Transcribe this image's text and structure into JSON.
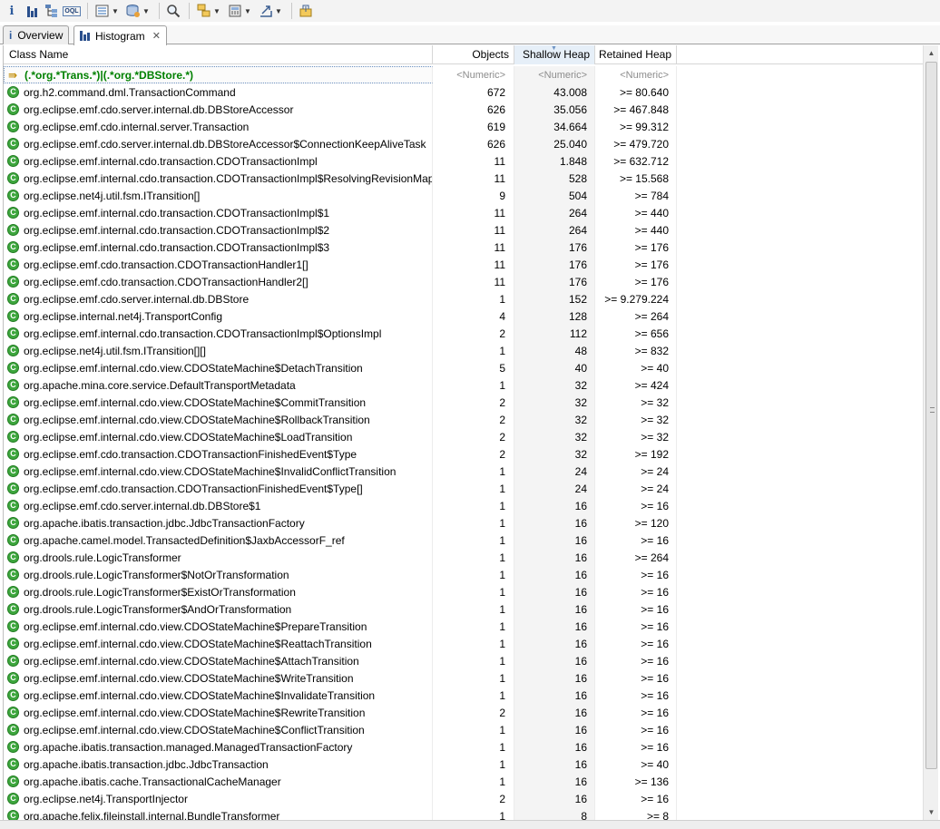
{
  "toolbar": {
    "buttons": [
      "info-icon",
      "histogram-icon",
      "dominator-tree-icon",
      "oql-icon",
      "query-browser-icon",
      "heap-dump-icon",
      "search-icon",
      "group-by-icon",
      "calculate-retained-icon",
      "export-icon",
      "pin-icon"
    ],
    "info_glyph": "i",
    "oql_glyph": "OQL"
  },
  "tabs": [
    {
      "label": "Overview",
      "icon": "i",
      "active": false
    },
    {
      "label": "Histogram",
      "icon": "histogram",
      "active": true,
      "close": "✕"
    }
  ],
  "table": {
    "columns": {
      "name": "Class Name",
      "objects": "Objects",
      "shallow": "Shallow Heap",
      "retained": "Retained Heap"
    },
    "filter": {
      "name": "(.*org.*Trans.*)|(.*org.*DBStore.*)",
      "objects": "<Numeric>",
      "shallow": "<Numeric>",
      "retained": "<Numeric>"
    },
    "rows": [
      {
        "name": "org.h2.command.dml.TransactionCommand",
        "objects": "672",
        "shallow": "43.008",
        "retained": ">= 80.640"
      },
      {
        "name": "org.eclipse.emf.cdo.server.internal.db.DBStoreAccessor",
        "objects": "626",
        "shallow": "35.056",
        "retained": ">= 467.848"
      },
      {
        "name": "org.eclipse.emf.cdo.internal.server.Transaction",
        "objects": "619",
        "shallow": "34.664",
        "retained": ">= 99.312"
      },
      {
        "name": "org.eclipse.emf.cdo.server.internal.db.DBStoreAccessor$ConnectionKeepAliveTask",
        "objects": "626",
        "shallow": "25.040",
        "retained": ">= 479.720"
      },
      {
        "name": "org.eclipse.emf.internal.cdo.transaction.CDOTransactionImpl",
        "objects": "11",
        "shallow": "1.848",
        "retained": ">= 632.712"
      },
      {
        "name": "org.eclipse.emf.internal.cdo.transaction.CDOTransactionImpl$ResolvingRevisionMap",
        "objects": "11",
        "shallow": "528",
        "retained": ">= 15.568"
      },
      {
        "name": "org.eclipse.net4j.util.fsm.ITransition[]",
        "objects": "9",
        "shallow": "504",
        "retained": ">= 784"
      },
      {
        "name": "org.eclipse.emf.internal.cdo.transaction.CDOTransactionImpl$1",
        "objects": "11",
        "shallow": "264",
        "retained": ">= 440"
      },
      {
        "name": "org.eclipse.emf.internal.cdo.transaction.CDOTransactionImpl$2",
        "objects": "11",
        "shallow": "264",
        "retained": ">= 440"
      },
      {
        "name": "org.eclipse.emf.internal.cdo.transaction.CDOTransactionImpl$3",
        "objects": "11",
        "shallow": "176",
        "retained": ">= 176"
      },
      {
        "name": "org.eclipse.emf.cdo.transaction.CDOTransactionHandler1[]",
        "objects": "11",
        "shallow": "176",
        "retained": ">= 176"
      },
      {
        "name": "org.eclipse.emf.cdo.transaction.CDOTransactionHandler2[]",
        "objects": "11",
        "shallow": "176",
        "retained": ">= 176"
      },
      {
        "name": "org.eclipse.emf.cdo.server.internal.db.DBStore",
        "objects": "1",
        "shallow": "152",
        "retained": ">= 9.279.224"
      },
      {
        "name": "org.eclipse.internal.net4j.TransportConfig",
        "objects": "4",
        "shallow": "128",
        "retained": ">= 264"
      },
      {
        "name": "org.eclipse.emf.internal.cdo.transaction.CDOTransactionImpl$OptionsImpl",
        "objects": "2",
        "shallow": "112",
        "retained": ">= 656"
      },
      {
        "name": "org.eclipse.net4j.util.fsm.ITransition[][]",
        "objects": "1",
        "shallow": "48",
        "retained": ">= 832"
      },
      {
        "name": "org.eclipse.emf.internal.cdo.view.CDOStateMachine$DetachTransition",
        "objects": "5",
        "shallow": "40",
        "retained": ">= 40"
      },
      {
        "name": "org.apache.mina.core.service.DefaultTransportMetadata",
        "objects": "1",
        "shallow": "32",
        "retained": ">= 424"
      },
      {
        "name": "org.eclipse.emf.internal.cdo.view.CDOStateMachine$CommitTransition",
        "objects": "2",
        "shallow": "32",
        "retained": ">= 32"
      },
      {
        "name": "org.eclipse.emf.internal.cdo.view.CDOStateMachine$RollbackTransition",
        "objects": "2",
        "shallow": "32",
        "retained": ">= 32"
      },
      {
        "name": "org.eclipse.emf.internal.cdo.view.CDOStateMachine$LoadTransition",
        "objects": "2",
        "shallow": "32",
        "retained": ">= 32"
      },
      {
        "name": "org.eclipse.emf.cdo.transaction.CDOTransactionFinishedEvent$Type",
        "objects": "2",
        "shallow": "32",
        "retained": ">= 192"
      },
      {
        "name": "org.eclipse.emf.internal.cdo.view.CDOStateMachine$InvalidConflictTransition",
        "objects": "1",
        "shallow": "24",
        "retained": ">= 24"
      },
      {
        "name": "org.eclipse.emf.cdo.transaction.CDOTransactionFinishedEvent$Type[]",
        "objects": "1",
        "shallow": "24",
        "retained": ">= 24"
      },
      {
        "name": "org.eclipse.emf.cdo.server.internal.db.DBStore$1",
        "objects": "1",
        "shallow": "16",
        "retained": ">= 16"
      },
      {
        "name": "org.apache.ibatis.transaction.jdbc.JdbcTransactionFactory",
        "objects": "1",
        "shallow": "16",
        "retained": ">= 120"
      },
      {
        "name": "org.apache.camel.model.TransactedDefinition$JaxbAccessorF_ref",
        "objects": "1",
        "shallow": "16",
        "retained": ">= 16"
      },
      {
        "name": "org.drools.rule.LogicTransformer",
        "objects": "1",
        "shallow": "16",
        "retained": ">= 264"
      },
      {
        "name": "org.drools.rule.LogicTransformer$NotOrTransformation",
        "objects": "1",
        "shallow": "16",
        "retained": ">= 16"
      },
      {
        "name": "org.drools.rule.LogicTransformer$ExistOrTransformation",
        "objects": "1",
        "shallow": "16",
        "retained": ">= 16"
      },
      {
        "name": "org.drools.rule.LogicTransformer$AndOrTransformation",
        "objects": "1",
        "shallow": "16",
        "retained": ">= 16"
      },
      {
        "name": "org.eclipse.emf.internal.cdo.view.CDOStateMachine$PrepareTransition",
        "objects": "1",
        "shallow": "16",
        "retained": ">= 16"
      },
      {
        "name": "org.eclipse.emf.internal.cdo.view.CDOStateMachine$ReattachTransition",
        "objects": "1",
        "shallow": "16",
        "retained": ">= 16"
      },
      {
        "name": "org.eclipse.emf.internal.cdo.view.CDOStateMachine$AttachTransition",
        "objects": "1",
        "shallow": "16",
        "retained": ">= 16"
      },
      {
        "name": "org.eclipse.emf.internal.cdo.view.CDOStateMachine$WriteTransition",
        "objects": "1",
        "shallow": "16",
        "retained": ">= 16"
      },
      {
        "name": "org.eclipse.emf.internal.cdo.view.CDOStateMachine$InvalidateTransition",
        "objects": "1",
        "shallow": "16",
        "retained": ">= 16"
      },
      {
        "name": "org.eclipse.emf.internal.cdo.view.CDOStateMachine$RewriteTransition",
        "objects": "2",
        "shallow": "16",
        "retained": ">= 16"
      },
      {
        "name": "org.eclipse.emf.internal.cdo.view.CDOStateMachine$ConflictTransition",
        "objects": "1",
        "shallow": "16",
        "retained": ">= 16"
      },
      {
        "name": "org.apache.ibatis.transaction.managed.ManagedTransactionFactory",
        "objects": "1",
        "shallow": "16",
        "retained": ">= 16"
      },
      {
        "name": "org.apache.ibatis.transaction.jdbc.JdbcTransaction",
        "objects": "1",
        "shallow": "16",
        "retained": ">= 40"
      },
      {
        "name": "org.apache.ibatis.cache.TransactionalCacheManager",
        "objects": "1",
        "shallow": "16",
        "retained": ">= 136"
      },
      {
        "name": "org.eclipse.net4j.TransportInjector",
        "objects": "2",
        "shallow": "16",
        "retained": ">= 16"
      },
      {
        "name": "org.apache.felix.fileinstall.internal.BundleTransformer",
        "objects": "1",
        "shallow": "8",
        "retained": ">= 8"
      }
    ]
  },
  "colors": {
    "class_icon": "#3da63d",
    "filter_text": "#008000",
    "sorted_column": "#e6eff8"
  }
}
